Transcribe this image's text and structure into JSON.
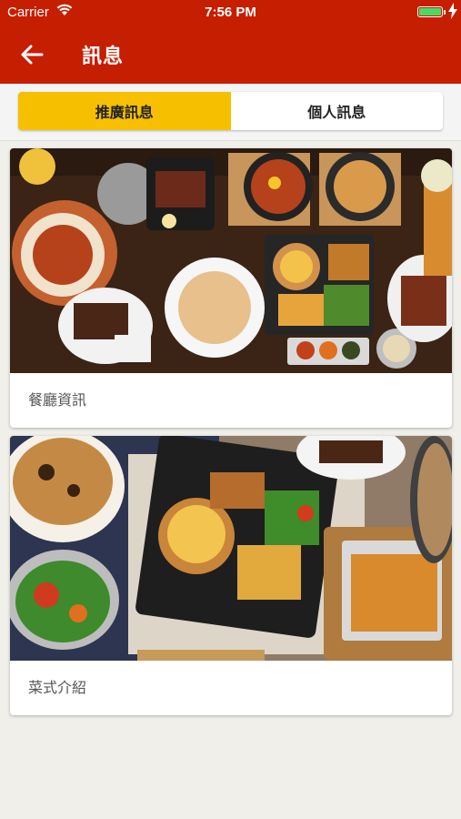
{
  "status_bar": {
    "carrier": "Carrier",
    "time": "7:56 PM",
    "battery_level_percent": 100,
    "battery_color": "#4cd964"
  },
  "nav": {
    "title": "訊息",
    "back_icon": "arrow-left-icon",
    "bar_color": "#c61e00"
  },
  "tabs": [
    {
      "label": "推廣訊息",
      "active": true
    },
    {
      "label": "個人訊息",
      "active": false
    }
  ],
  "accent_color": "#f6c000",
  "cards": [
    {
      "caption": "餐廳資訊",
      "image": "restaurant-food-table-photo"
    },
    {
      "caption": "菜式介紹",
      "image": "dishes-platter-photo"
    }
  ]
}
